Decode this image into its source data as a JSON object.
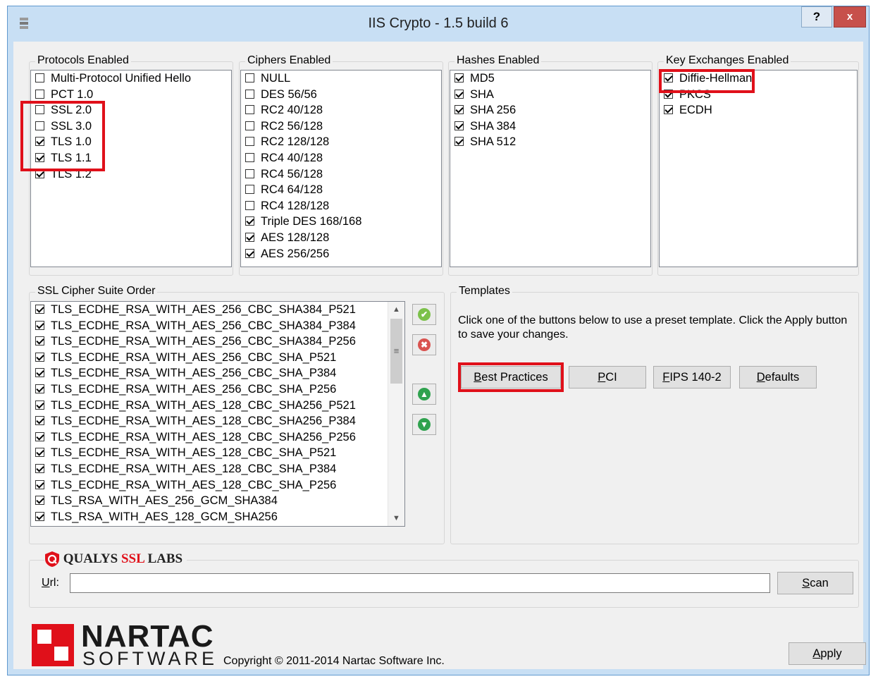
{
  "window": {
    "title": "IIS Crypto - 1.5 build 6",
    "help_label": "?",
    "close_label": "x"
  },
  "protocols": {
    "label": "Protocols Enabled",
    "items": [
      {
        "label": "Multi-Protocol Unified Hello",
        "checked": false
      },
      {
        "label": "PCT 1.0",
        "checked": false
      },
      {
        "label": "SSL 2.0",
        "checked": false
      },
      {
        "label": "SSL 3.0",
        "checked": false
      },
      {
        "label": "TLS 1.0",
        "checked": true
      },
      {
        "label": "TLS 1.1",
        "checked": true
      },
      {
        "label": "TLS 1.2",
        "checked": true
      }
    ]
  },
  "ciphers": {
    "label": "Ciphers Enabled",
    "items": [
      {
        "label": "NULL",
        "checked": false
      },
      {
        "label": "DES 56/56",
        "checked": false
      },
      {
        "label": "RC2 40/128",
        "checked": false
      },
      {
        "label": "RC2 56/128",
        "checked": false
      },
      {
        "label": "RC2 128/128",
        "checked": false
      },
      {
        "label": "RC4 40/128",
        "checked": false
      },
      {
        "label": "RC4 56/128",
        "checked": false
      },
      {
        "label": "RC4 64/128",
        "checked": false
      },
      {
        "label": "RC4 128/128",
        "checked": false
      },
      {
        "label": "Triple DES 168/168",
        "checked": true
      },
      {
        "label": "AES 128/128",
        "checked": true
      },
      {
        "label": "AES 256/256",
        "checked": true
      }
    ]
  },
  "hashes": {
    "label": "Hashes Enabled",
    "items": [
      {
        "label": "MD5",
        "checked": true
      },
      {
        "label": "SHA",
        "checked": true
      },
      {
        "label": "SHA 256",
        "checked": true
      },
      {
        "label": "SHA 384",
        "checked": true
      },
      {
        "label": "SHA 512",
        "checked": true
      }
    ]
  },
  "key_exchanges": {
    "label": "Key Exchanges Enabled",
    "items": [
      {
        "label": "Diffie-Hellman",
        "checked": true
      },
      {
        "label": "PKCS",
        "checked": true
      },
      {
        "label": "ECDH",
        "checked": true
      }
    ]
  },
  "cipher_suites": {
    "label": "SSL Cipher Suite Order",
    "items": [
      {
        "label": "TLS_ECDHE_RSA_WITH_AES_256_CBC_SHA384_P521",
        "checked": true
      },
      {
        "label": "TLS_ECDHE_RSA_WITH_AES_256_CBC_SHA384_P384",
        "checked": true
      },
      {
        "label": "TLS_ECDHE_RSA_WITH_AES_256_CBC_SHA384_P256",
        "checked": true
      },
      {
        "label": "TLS_ECDHE_RSA_WITH_AES_256_CBC_SHA_P521",
        "checked": true
      },
      {
        "label": "TLS_ECDHE_RSA_WITH_AES_256_CBC_SHA_P384",
        "checked": true
      },
      {
        "label": "TLS_ECDHE_RSA_WITH_AES_256_CBC_SHA_P256",
        "checked": true
      },
      {
        "label": "TLS_ECDHE_RSA_WITH_AES_128_CBC_SHA256_P521",
        "checked": true
      },
      {
        "label": "TLS_ECDHE_RSA_WITH_AES_128_CBC_SHA256_P384",
        "checked": true
      },
      {
        "label": "TLS_ECDHE_RSA_WITH_AES_128_CBC_SHA256_P256",
        "checked": true
      },
      {
        "label": "TLS_ECDHE_RSA_WITH_AES_128_CBC_SHA_P521",
        "checked": true
      },
      {
        "label": "TLS_ECDHE_RSA_WITH_AES_128_CBC_SHA_P384",
        "checked": true
      },
      {
        "label": "TLS_ECDHE_RSA_WITH_AES_128_CBC_SHA_P256",
        "checked": true
      },
      {
        "label": "TLS_RSA_WITH_AES_256_GCM_SHA384",
        "checked": true
      },
      {
        "label": "TLS_RSA_WITH_AES_128_GCM_SHA256",
        "checked": true
      }
    ],
    "side_buttons": {
      "enable_icon": "checkmark-icon",
      "disable_icon": "disable-icon",
      "up_icon": "move-up-icon",
      "down_icon": "move-down-icon"
    }
  },
  "templates": {
    "label": "Templates",
    "description": "Click one of the buttons below to use a preset template. Click the Apply button to save your changes.",
    "buttons": {
      "best_practices": {
        "accel": "B",
        "rest": "est Practices"
      },
      "pci": {
        "accel": "P",
        "rest": "CI"
      },
      "fips": {
        "accel": "F",
        "rest": "IPS 140-2"
      },
      "defaults": {
        "accel": "D",
        "rest": "efaults"
      }
    }
  },
  "qualys": {
    "brand": "QUALYS",
    "ssl": "SSL",
    "labs": "LABS",
    "url_label": {
      "accel": "U",
      "rest": "rl:"
    },
    "url_value": "",
    "scan": {
      "accel": "S",
      "rest": "can"
    }
  },
  "footer": {
    "brand_name": "NARTAC",
    "brand_sub": "SOFTWARE",
    "copyright": "Copyright © 2011-2014 Nartac Software Inc.",
    "apply": {
      "accel": "A",
      "rest": "pply"
    }
  },
  "colors": {
    "highlight": "#e0101a",
    "accent": "#c8dff4",
    "close": "#c7504b",
    "brand_red": "#e0101a"
  }
}
